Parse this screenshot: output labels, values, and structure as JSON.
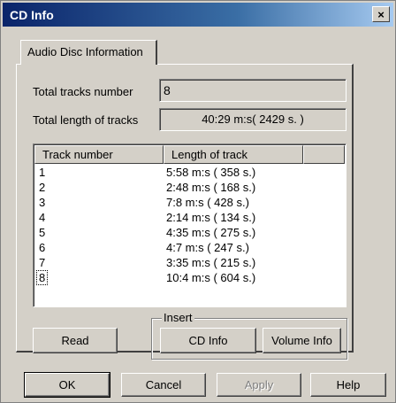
{
  "window": {
    "title": "CD Info",
    "close_symbol": "×"
  },
  "tab": {
    "label": "Audio Disc Information"
  },
  "fields": {
    "total_tracks_label": "Total tracks number",
    "total_tracks_value": "8",
    "total_length_label": "Total length of tracks",
    "total_length_value": "40:29 m:s( 2429 s. )"
  },
  "list": {
    "headers": [
      "Track number",
      "Length of track",
      ""
    ],
    "rows": [
      {
        "track": "1",
        "length": "5:58 m:s ( 358 s.)"
      },
      {
        "track": "2",
        "length": "2:48 m:s ( 168 s.)"
      },
      {
        "track": "3",
        "length": "7:8 m:s ( 428 s.)"
      },
      {
        "track": "4",
        "length": "2:14 m:s ( 134 s.)"
      },
      {
        "track": "5",
        "length": "4:35 m:s ( 275 s.)"
      },
      {
        "track": "6",
        "length": "4:7 m:s ( 247 s.)"
      },
      {
        "track": "7",
        "length": "3:35 m:s ( 215 s.)"
      },
      {
        "track": "8",
        "length": "10:4 m:s ( 604 s.)"
      }
    ]
  },
  "buttons": {
    "read": "Read",
    "insert_group": "Insert",
    "cd_info": "CD Info",
    "volume_info": "Volume Info",
    "ok": "OK",
    "cancel": "Cancel",
    "apply": "Apply",
    "help": "Help"
  }
}
